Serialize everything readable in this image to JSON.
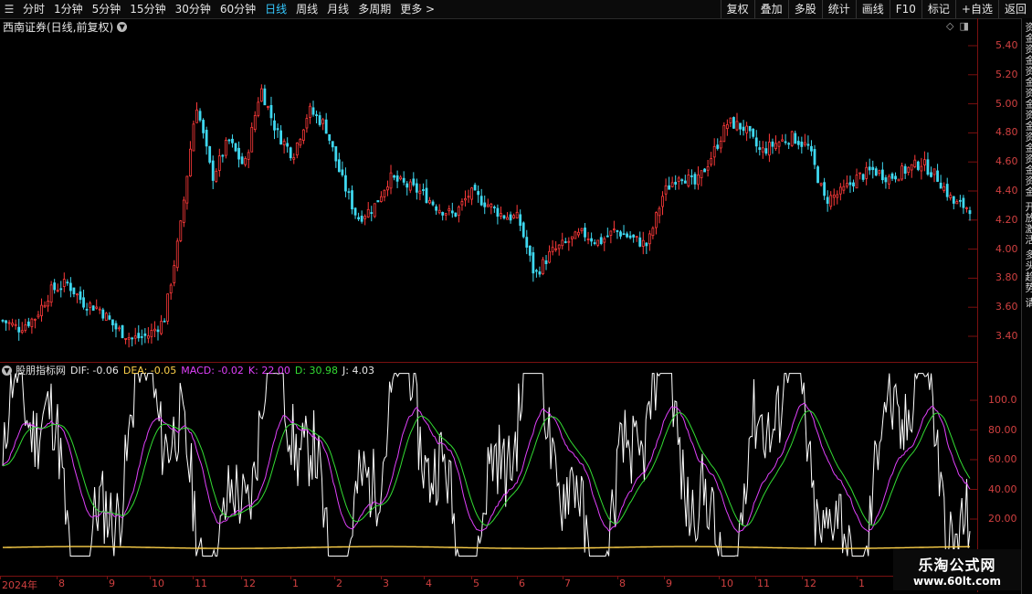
{
  "toolbar": {
    "periods": [
      {
        "label": "分时",
        "active": false
      },
      {
        "label": "1分钟",
        "active": false
      },
      {
        "label": "5分钟",
        "active": false
      },
      {
        "label": "15分钟",
        "active": false
      },
      {
        "label": "30分钟",
        "active": false
      },
      {
        "label": "60分钟",
        "active": false
      },
      {
        "label": "日线",
        "active": true
      },
      {
        "label": "周线",
        "active": false
      },
      {
        "label": "月线",
        "active": false
      },
      {
        "label": "多周期",
        "active": false
      },
      {
        "label": "更多 >",
        "active": false
      }
    ],
    "right_buttons": [
      "复权",
      "叠加",
      "多股",
      "统计",
      "画线",
      "F10",
      "标记",
      "+自选",
      "返回"
    ]
  },
  "stock": {
    "title": "西南证券(日线,前复权)"
  },
  "price_axis": [
    "5.40",
    "5.20",
    "5.00",
    "4.80",
    "4.60",
    "4.40",
    "4.20",
    "4.00",
    "3.80",
    "3.60",
    "3.40"
  ],
  "indicator": {
    "name": "股朋指标网",
    "dif": "DIF: -0.06",
    "dea": "DEA: -0.05",
    "macd": "MACD: -0.02",
    "k": "K: 22.00",
    "d": "D: 30.98",
    "j": "J: 4.03",
    "axis": [
      "100.0",
      "80.00",
      "60.00",
      "40.00",
      "20.00"
    ]
  },
  "date_axis": [
    "2024年",
    "8",
    "9",
    "10",
    "11",
    "12",
    "1",
    "2",
    "3",
    "4",
    "5",
    "6",
    "7",
    "8",
    "9",
    "10",
    "11",
    "12",
    "1"
  ],
  "side_panel": {
    "text": "资金资金资金资金资金资金资金资金 开放激活 多头趋势 请"
  },
  "watermark": {
    "line1": "乐淘公式网",
    "line2": "www.60lt.com"
  },
  "colors": {
    "up": "#ff3a3a",
    "down": "#3fd8f0",
    "k": "#ffffff",
    "d": "#e040fb",
    "j": "#33dd33",
    "dea": "#ffd24a",
    "axis": "#d04040"
  },
  "chart_data": {
    "type": "candlestick",
    "title": "西南证券(日线,前复权)",
    "ylim": [
      3.35,
      5.5
    ],
    "price_path": [
      3.6,
      3.55,
      3.62,
      3.8,
      3.85,
      3.72,
      3.68,
      3.55,
      3.48,
      3.5,
      3.6,
      4.2,
      5.05,
      4.55,
      4.8,
      4.62,
      5.15,
      4.85,
      4.7,
      5.0,
      4.9,
      4.55,
      4.28,
      4.35,
      4.55,
      4.5,
      4.45,
      4.35,
      4.3,
      4.45,
      4.38,
      4.3,
      4.28,
      3.9,
      4.05,
      4.12,
      4.18,
      4.12,
      4.2,
      4.15,
      4.1,
      4.45,
      4.58,
      4.5,
      4.7,
      4.92,
      4.88,
      4.72,
      4.78,
      4.82,
      4.75,
      4.4,
      4.45,
      4.55,
      4.6,
      4.55,
      4.6,
      4.65,
      4.55,
      4.38,
      4.35
    ],
    "indicator_ylim": [
      0,
      110
    ]
  }
}
